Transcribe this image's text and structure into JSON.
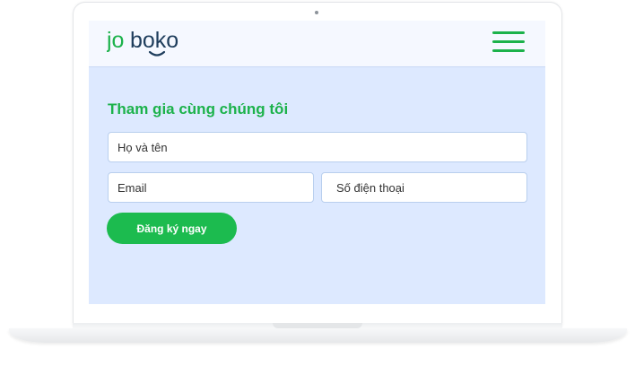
{
  "brand": {
    "name": "joboko",
    "accent_color": "#1cb24b",
    "dark_color": "#1e3d5c"
  },
  "header": {
    "menu_icon": "hamburger-menu-icon"
  },
  "form": {
    "title": "Tham gia cùng chúng tôi",
    "name_placeholder": "Họ và tên",
    "email_placeholder": "Email",
    "phone_placeholder": "Số điện thoại",
    "submit_label": "Đăng ký ngay",
    "background_color": "#dde9ff"
  }
}
